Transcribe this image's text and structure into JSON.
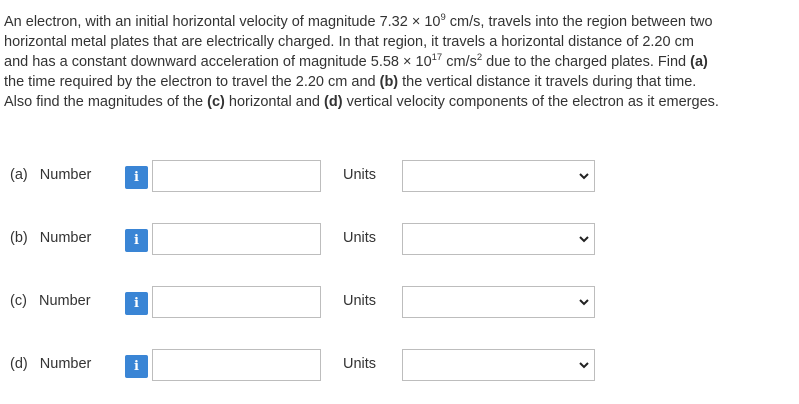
{
  "question": {
    "l1_a": "An electron, with an initial horizontal velocity of magnitude 7.32 × 10",
    "l1_exp": "9",
    "l1_b": " cm/s, travels into the region between two",
    "l2": "horizontal metal plates that are electrically charged. In that region, it travels a horizontal distance of 2.20 cm",
    "l3_a": "and has a constant downward acceleration of magnitude 5.58 × 10",
    "l3_exp": "17",
    "l3_b": " cm/s",
    "l3_exp2": "2",
    "l3_c": " due to the charged plates. Find ",
    "l3_bold": "(a)",
    "l4_a": "the time required by the electron to travel the 2.20 cm and ",
    "l4_bold": "(b)",
    "l4_b": " the vertical distance it travels during that time.",
    "l5_a": "Also find the magnitudes of the ",
    "l5_bold1": "(c)",
    "l5_b": " horizontal and ",
    "l5_bold2": "(d)",
    "l5_c": " vertical velocity components of the electron as it emerges."
  },
  "parts": [
    {
      "label": "(a)   Number",
      "info_glyph": "i",
      "value": "",
      "units_label": "Units",
      "units_value": ""
    },
    {
      "label": "(b)   Number",
      "info_glyph": "i",
      "value": "",
      "units_label": "Units",
      "units_value": ""
    },
    {
      "label": "(c)   Number",
      "info_glyph": "i",
      "value": "",
      "units_label": "Units",
      "units_value": ""
    },
    {
      "label": "(d)   Number",
      "info_glyph": "i",
      "value": "",
      "units_label": "Units",
      "units_value": ""
    }
  ],
  "icons": {
    "info": "info-icon",
    "dropdown": "chevron-down-icon"
  },
  "colors": {
    "info_button": "#3a85d5",
    "border": "#bdbdbd",
    "text": "#333333"
  }
}
